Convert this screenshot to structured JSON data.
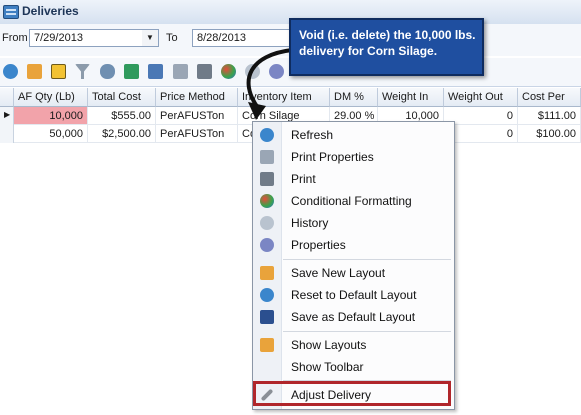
{
  "window": {
    "title": "Deliveries"
  },
  "filter": {
    "from_label": "From",
    "from_value": "7/29/2013",
    "to_label": "To",
    "to_value": "8/28/2013"
  },
  "grid": {
    "columns": [
      "AF Qty (Lb)",
      "Total Cost",
      "Price Method",
      "Inventory Item",
      "DM %",
      "Weight In",
      "Weight Out",
      "Cost Per"
    ],
    "rows": [
      {
        "af_qty": "10,000",
        "total_cost": "$555.00",
        "price_method": "PerAFUSTon",
        "inventory_item": "Corn Silage",
        "dm": "29.00 %",
        "weight_in": "10,000",
        "weight_out": "0",
        "cost_per": "$111.00"
      },
      {
        "af_qty": "50,000",
        "total_cost": "$2,500.00",
        "price_method": "PerAFUSTon",
        "inventory_item": "Co",
        "dm": "",
        "weight_in": "",
        "weight_out": "0",
        "cost_per": "$100.00"
      }
    ]
  },
  "context_menu": {
    "items": [
      {
        "label": "Refresh",
        "icon": "refresh-icon"
      },
      {
        "label": "Print Properties",
        "icon": "print-properties-icon"
      },
      {
        "label": "Print",
        "icon": "printer-icon"
      },
      {
        "label": "Conditional Formatting",
        "icon": "conditional-formatting-icon"
      },
      {
        "label": "History",
        "icon": "history-icon"
      },
      {
        "label": "Properties",
        "icon": "gear-icon"
      },
      {
        "label": "Save New Layout",
        "icon": "save-layout-icon"
      },
      {
        "label": "Reset to Default Layout",
        "icon": "reset-layout-icon"
      },
      {
        "label": "Save as Default Layout",
        "icon": "floppy-icon"
      },
      {
        "label": "Show Layouts",
        "icon": "layouts-icon"
      },
      {
        "label": "Show Toolbar",
        "icon": ""
      },
      {
        "label": "Adjust Delivery",
        "icon": "wrench-icon"
      }
    ]
  },
  "callout": {
    "text": "Void (i.e. delete) the 10,000 lbs. delivery for Corn Silage."
  },
  "colors": {
    "highlight_cell": "#f2a3aa",
    "callout_bg": "#1f4fa0",
    "menu_highlight_border": "#b0262b"
  }
}
